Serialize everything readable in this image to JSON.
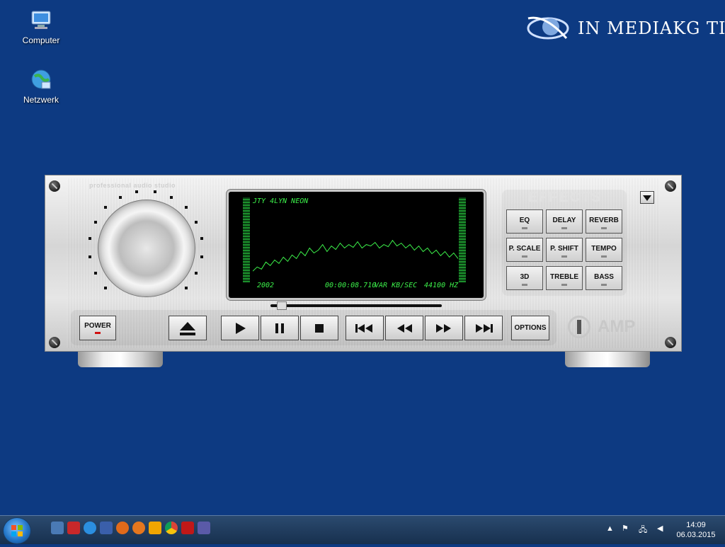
{
  "desktop": {
    "icons": [
      {
        "label": "Computer"
      },
      {
        "label": "Netzwerk"
      }
    ],
    "watermark": "IN MEDIAKG TI"
  },
  "player": {
    "brand": "professional audio studio",
    "effects_title": "EFFECTS",
    "display": {
      "track_title": "JTY 4LYN NEON",
      "year": "2002",
      "time": "00:00:08.710",
      "bitrate": "VAR KB/SEC",
      "samplerate": "44100 HZ"
    },
    "effects": [
      "EQ",
      "DELAY",
      "REVERB",
      "P. SCALE",
      "P. SHIFT",
      "TEMPO",
      "3D",
      "TREBLE",
      "BASS"
    ],
    "buttons": {
      "power": "POWER",
      "options": "OPTIONS"
    },
    "logo_text": "AMP",
    "seek_fraction": 0.06,
    "waveform": [
      0.22,
      0.28,
      0.25,
      0.35,
      0.3,
      0.38,
      0.33,
      0.42,
      0.36,
      0.45,
      0.4,
      0.5,
      0.44,
      0.55,
      0.48,
      0.52,
      0.6,
      0.5,
      0.58,
      0.53,
      0.62,
      0.55,
      0.6,
      0.56,
      0.64,
      0.55,
      0.6,
      0.58,
      0.63,
      0.55,
      0.6,
      0.57,
      0.66,
      0.58,
      0.62,
      0.55,
      0.6,
      0.52,
      0.58,
      0.5,
      0.55,
      0.47,
      0.52,
      0.44,
      0.5,
      0.42,
      0.48,
      0.4
    ]
  },
  "taskbar": {
    "time": "14:09",
    "date": "06.03.2015"
  },
  "colors": {
    "desktop_bg": "#0d3a82",
    "lcd_green": "#3cf04a"
  }
}
